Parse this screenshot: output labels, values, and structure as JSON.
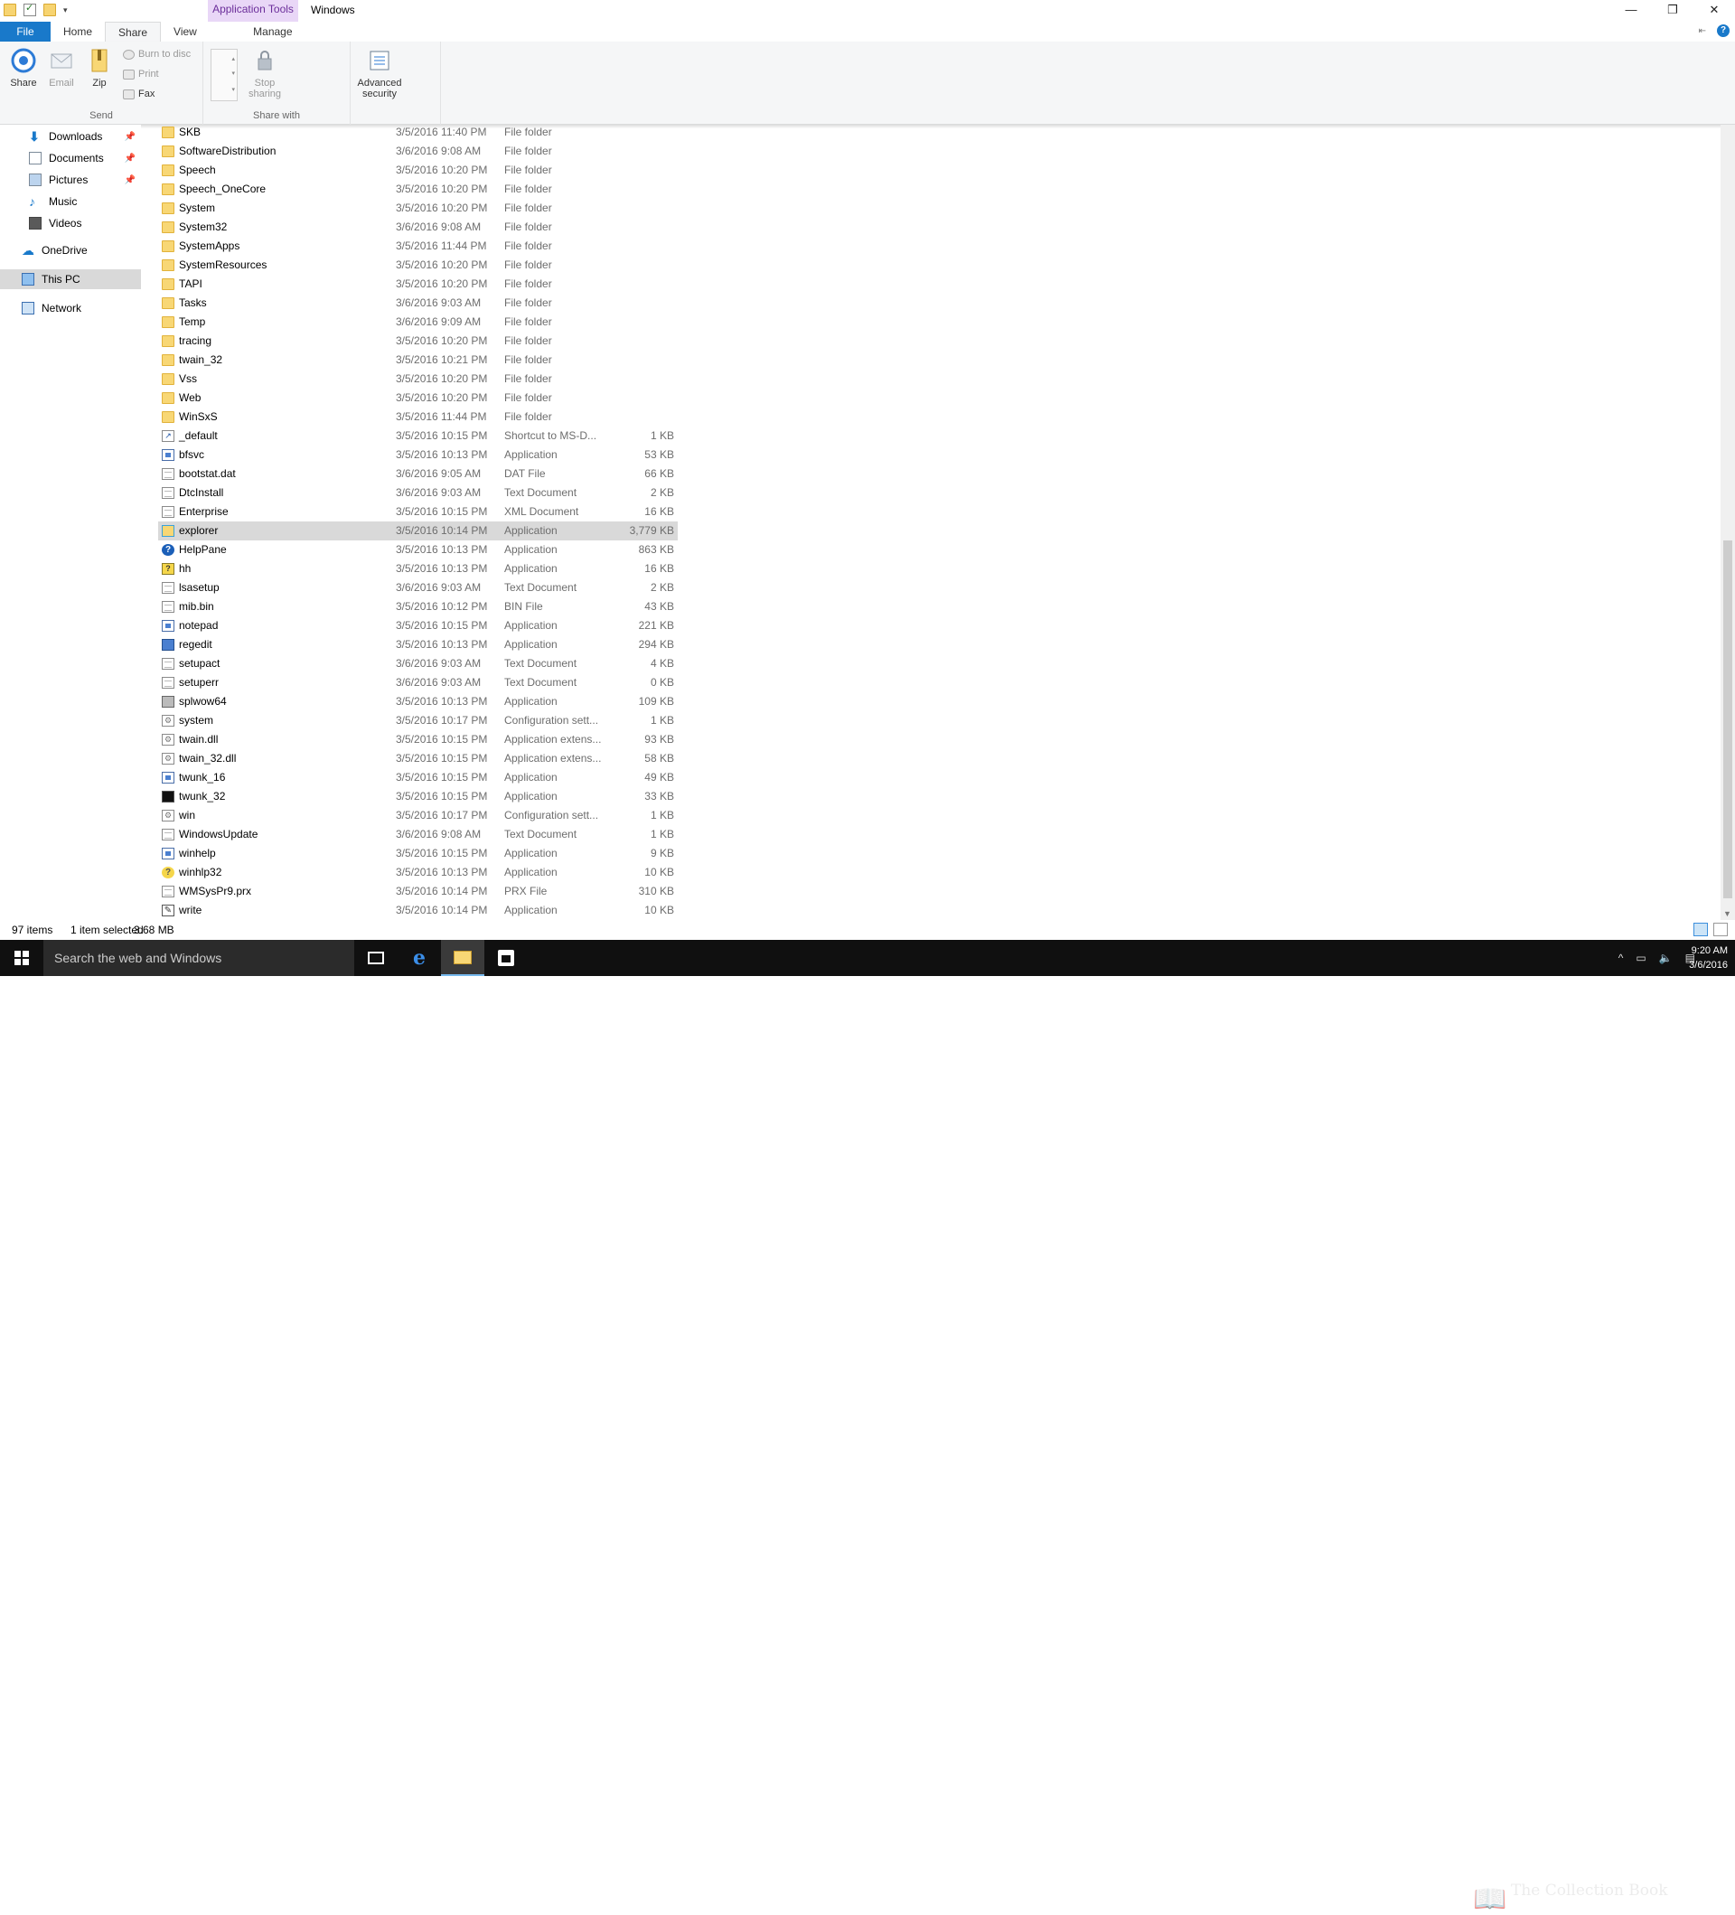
{
  "titlebar": {
    "context_tab": "Application Tools",
    "title": "Windows",
    "minimize": "—",
    "maximize": "❐",
    "close": "✕"
  },
  "ribbon_tabs": {
    "file": "File",
    "home": "Home",
    "share": "Share",
    "view": "View",
    "manage": "Manage"
  },
  "ribbon": {
    "send_group": "Send",
    "share_with_group": "Share with",
    "share": "Share",
    "email": "Email",
    "zip": "Zip",
    "burn": "Burn to disc",
    "print": "Print",
    "fax": "Fax",
    "stop_sharing_1": "Stop",
    "stop_sharing_2": "sharing",
    "advanced_1": "Advanced",
    "advanced_2": "security"
  },
  "nav": {
    "downloads": "Downloads",
    "documents": "Documents",
    "pictures": "Pictures",
    "music": "Music",
    "videos": "Videos",
    "onedrive": "OneDrive",
    "this_pc": "This PC",
    "network": "Network"
  },
  "files": [
    {
      "name": "SKB",
      "date": "3/5/2016 11:40 PM",
      "type": "File folder",
      "size": "",
      "icon": "folder"
    },
    {
      "name": "SoftwareDistribution",
      "date": "3/6/2016 9:08 AM",
      "type": "File folder",
      "size": "",
      "icon": "folder"
    },
    {
      "name": "Speech",
      "date": "3/5/2016 10:20 PM",
      "type": "File folder",
      "size": "",
      "icon": "folder"
    },
    {
      "name": "Speech_OneCore",
      "date": "3/5/2016 10:20 PM",
      "type": "File folder",
      "size": "",
      "icon": "folder"
    },
    {
      "name": "System",
      "date": "3/5/2016 10:20 PM",
      "type": "File folder",
      "size": "",
      "icon": "folder"
    },
    {
      "name": "System32",
      "date": "3/6/2016 9:08 AM",
      "type": "File folder",
      "size": "",
      "icon": "folder"
    },
    {
      "name": "SystemApps",
      "date": "3/5/2016 11:44 PM",
      "type": "File folder",
      "size": "",
      "icon": "folder"
    },
    {
      "name": "SystemResources",
      "date": "3/5/2016 10:20 PM",
      "type": "File folder",
      "size": "",
      "icon": "folder"
    },
    {
      "name": "TAPI",
      "date": "3/5/2016 10:20 PM",
      "type": "File folder",
      "size": "",
      "icon": "folder"
    },
    {
      "name": "Tasks",
      "date": "3/6/2016 9:03 AM",
      "type": "File folder",
      "size": "",
      "icon": "folder"
    },
    {
      "name": "Temp",
      "date": "3/6/2016 9:09 AM",
      "type": "File folder",
      "size": "",
      "icon": "folder"
    },
    {
      "name": "tracing",
      "date": "3/5/2016 10:20 PM",
      "type": "File folder",
      "size": "",
      "icon": "folder"
    },
    {
      "name": "twain_32",
      "date": "3/5/2016 10:21 PM",
      "type": "File folder",
      "size": "",
      "icon": "folder"
    },
    {
      "name": "Vss",
      "date": "3/5/2016 10:20 PM",
      "type": "File folder",
      "size": "",
      "icon": "folder"
    },
    {
      "name": "Web",
      "date": "3/5/2016 10:20 PM",
      "type": "File folder",
      "size": "",
      "icon": "folder"
    },
    {
      "name": "WinSxS",
      "date": "3/5/2016 11:44 PM",
      "type": "File folder",
      "size": "",
      "icon": "folder"
    },
    {
      "name": "_default",
      "date": "3/5/2016 10:15 PM",
      "type": "Shortcut to MS-D...",
      "size": "1 KB",
      "icon": "shortcut"
    },
    {
      "name": "bfsvc",
      "date": "3/5/2016 10:13 PM",
      "type": "Application",
      "size": "53 KB",
      "icon": "app"
    },
    {
      "name": "bootstat.dat",
      "date": "3/6/2016 9:05 AM",
      "type": "DAT File",
      "size": "66 KB",
      "icon": "doc"
    },
    {
      "name": "DtcInstall",
      "date": "3/6/2016 9:03 AM",
      "type": "Text Document",
      "size": "2 KB",
      "icon": "doc"
    },
    {
      "name": "Enterprise",
      "date": "3/5/2016 10:15 PM",
      "type": "XML Document",
      "size": "16 KB",
      "icon": "doc"
    },
    {
      "name": "explorer",
      "date": "3/5/2016 10:14 PM",
      "type": "Application",
      "size": "3,779 KB",
      "icon": "explorer",
      "selected": true
    },
    {
      "name": "HelpPane",
      "date": "3/5/2016 10:13 PM",
      "type": "Application",
      "size": "863 KB",
      "icon": "help"
    },
    {
      "name": "hh",
      "date": "3/5/2016 10:13 PM",
      "type": "Application",
      "size": "16 KB",
      "icon": "hh"
    },
    {
      "name": "lsasetup",
      "date": "3/6/2016 9:03 AM",
      "type": "Text Document",
      "size": "2 KB",
      "icon": "doc"
    },
    {
      "name": "mib.bin",
      "date": "3/5/2016 10:12 PM",
      "type": "BIN File",
      "size": "43 KB",
      "icon": "doc"
    },
    {
      "name": "notepad",
      "date": "3/5/2016 10:15 PM",
      "type": "Application",
      "size": "221 KB",
      "icon": "app"
    },
    {
      "name": "regedit",
      "date": "3/5/2016 10:13 PM",
      "type": "Application",
      "size": "294 KB",
      "icon": "regedit"
    },
    {
      "name": "setupact",
      "date": "3/6/2016 9:03 AM",
      "type": "Text Document",
      "size": "4 KB",
      "icon": "doc"
    },
    {
      "name": "setuperr",
      "date": "3/6/2016 9:03 AM",
      "type": "Text Document",
      "size": "0 KB",
      "icon": "doc"
    },
    {
      "name": "splwow64",
      "date": "3/5/2016 10:13 PM",
      "type": "Application",
      "size": "109 KB",
      "icon": "print"
    },
    {
      "name": "system",
      "date": "3/5/2016 10:17 PM",
      "type": "Configuration sett...",
      "size": "1 KB",
      "icon": "gear"
    },
    {
      "name": "twain.dll",
      "date": "3/5/2016 10:15 PM",
      "type": "Application extens...",
      "size": "93 KB",
      "icon": "gear"
    },
    {
      "name": "twain_32.dll",
      "date": "3/5/2016 10:15 PM",
      "type": "Application extens...",
      "size": "58 KB",
      "icon": "gear"
    },
    {
      "name": "twunk_16",
      "date": "3/5/2016 10:15 PM",
      "type": "Application",
      "size": "49 KB",
      "icon": "app"
    },
    {
      "name": "twunk_32",
      "date": "3/5/2016 10:15 PM",
      "type": "Application",
      "size": "33 KB",
      "icon": "twunk"
    },
    {
      "name": "win",
      "date": "3/5/2016 10:17 PM",
      "type": "Configuration sett...",
      "size": "1 KB",
      "icon": "gear"
    },
    {
      "name": "WindowsUpdate",
      "date": "3/6/2016 9:08 AM",
      "type": "Text Document",
      "size": "1 KB",
      "icon": "doc"
    },
    {
      "name": "winhelp",
      "date": "3/5/2016 10:15 PM",
      "type": "Application",
      "size": "9 KB",
      "icon": "app"
    },
    {
      "name": "winhlp32",
      "date": "3/5/2016 10:13 PM",
      "type": "Application",
      "size": "10 KB",
      "icon": "winhlp"
    },
    {
      "name": "WMSysPr9.prx",
      "date": "3/5/2016 10:14 PM",
      "type": "PRX File",
      "size": "310 KB",
      "icon": "doc"
    },
    {
      "name": "write",
      "date": "3/5/2016 10:14 PM",
      "type": "Application",
      "size": "10 KB",
      "icon": "write"
    }
  ],
  "status": {
    "items": "97 items",
    "selected": "1 item selected",
    "size": "3.68 MB"
  },
  "taskbar": {
    "search_placeholder": "Search the web and Windows",
    "watermark": "The Collection Book",
    "time": "9:20 AM",
    "date": "3/6/2016"
  }
}
